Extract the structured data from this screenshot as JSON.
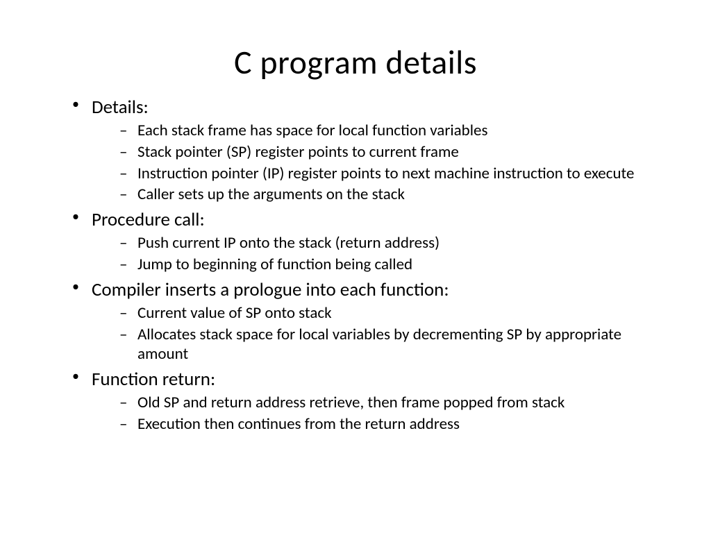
{
  "title": "C program details",
  "bullets": [
    {
      "label": "Details:",
      "sub": [
        "Each stack frame has space for local function variables",
        "Stack pointer (SP) register points to current frame",
        "Instruction pointer (IP) register points to next machine instruction to execute",
        "Caller sets up the arguments on the stack"
      ]
    },
    {
      "label": "Procedure call:",
      "sub": [
        "Push current IP onto the stack (return address)",
        "Jump to beginning of function being called"
      ]
    },
    {
      "label": "Compiler inserts a prologue into each function:",
      "sub": [
        "Current value of SP onto stack",
        "Allocates stack space for local variables by decrementing SP by appropriate amount"
      ]
    },
    {
      "label": "Function return:",
      "sub": [
        "Old SP and return address retrieve, then frame popped from stack",
        "Execution then continues from the return address"
      ]
    }
  ]
}
